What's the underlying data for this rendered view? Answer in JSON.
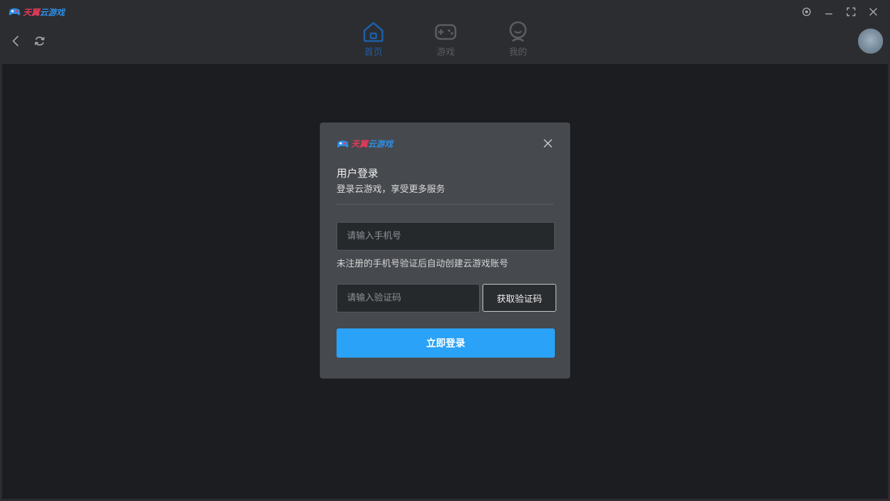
{
  "app": {
    "logo_red": "天翼",
    "logo_blue": "云游戏"
  },
  "header": {
    "tabs": [
      {
        "label": "首页",
        "icon": "home-icon",
        "active": true
      },
      {
        "label": "游戏",
        "icon": "gamepad-icon",
        "active": false
      },
      {
        "label": "我的",
        "icon": "user-icon",
        "active": false
      }
    ]
  },
  "dialog": {
    "logo_red": "天翼",
    "logo_blue": "云游戏",
    "title": "用户登录",
    "subtitle": "登录云游戏，享受更多服务",
    "phone_placeholder": "请输入手机号",
    "hint": "未注册的手机号验证后自动创建云游戏账号",
    "code_placeholder": "请输入验证码",
    "get_code_label": "获取验证码",
    "login_label": "立即登录"
  },
  "colors": {
    "accent": "#2aa2f7",
    "active_tab": "#1e5fa8",
    "logo_red": "#e23b5a",
    "logo_blue": "#2f8ee6"
  }
}
